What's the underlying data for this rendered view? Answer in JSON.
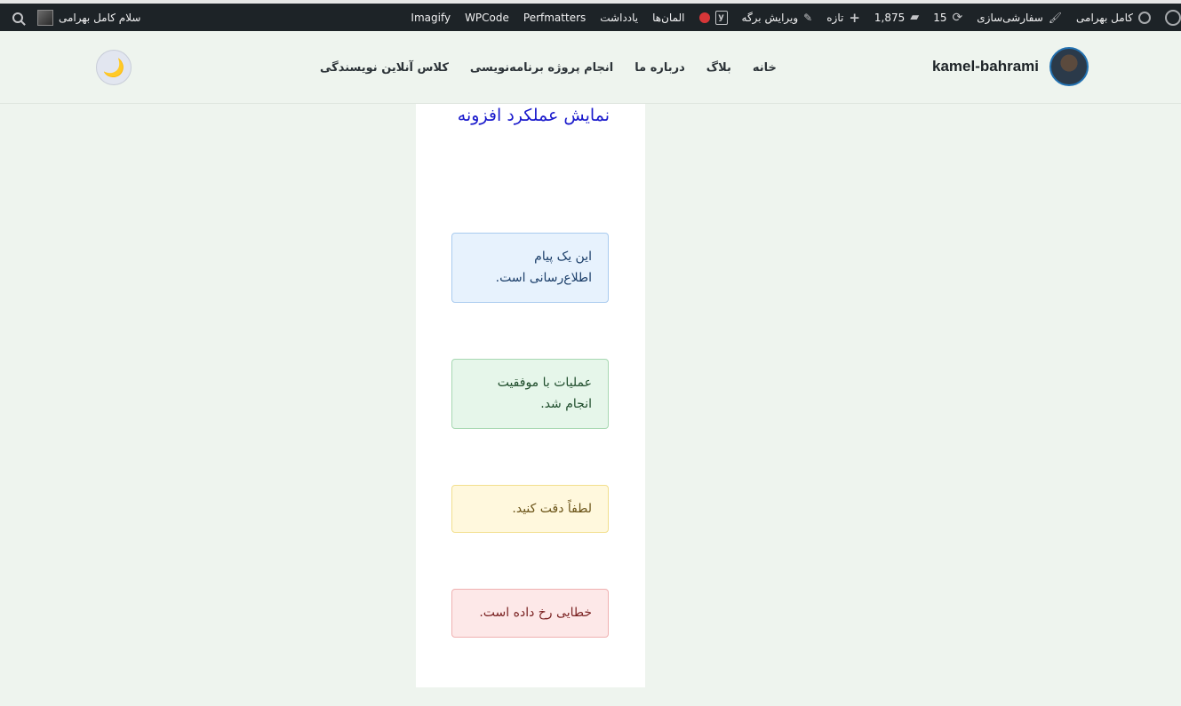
{
  "adminbar": {
    "site_name": "کامل بهرامی",
    "customize": "سفارشی‌سازی",
    "updates_count": "15",
    "comments_count": "1,875",
    "new_label": "تازه",
    "edit_page": "ویرایش برگه",
    "elements": "المان‌ها",
    "notes": "یادداشت",
    "perfmatters": "Perfmatters",
    "wpcode": "WPCode",
    "imagify": "Imagify",
    "greeting": "سلام کامل بهرامی"
  },
  "header": {
    "brand_name": "kamel-bahrami",
    "nav": [
      "خانه",
      "بلاگ",
      "درباره ما",
      "انجام پروژه برنامه‌نویسی",
      "کلاس آنلاین نویسندگی"
    ],
    "theme_icon": "🌙"
  },
  "main": {
    "title": "نمایش عملکرد افزونه",
    "notices": {
      "info": "این یک پیام اطلاع‌رسانی است.",
      "success": "عملیات با موفقیت انجام شد.",
      "warning": "لطفاً دقت کنید.",
      "error": "خطایی رخ داده است."
    }
  },
  "colors": {
    "adminbar_bg": "#1d2327",
    "title_blue": "#1a1acc",
    "info_bg": "#e7f2fd",
    "success_bg": "#e6f6ea",
    "warning_bg": "#fff8dd",
    "error_bg": "#fde8e8"
  }
}
